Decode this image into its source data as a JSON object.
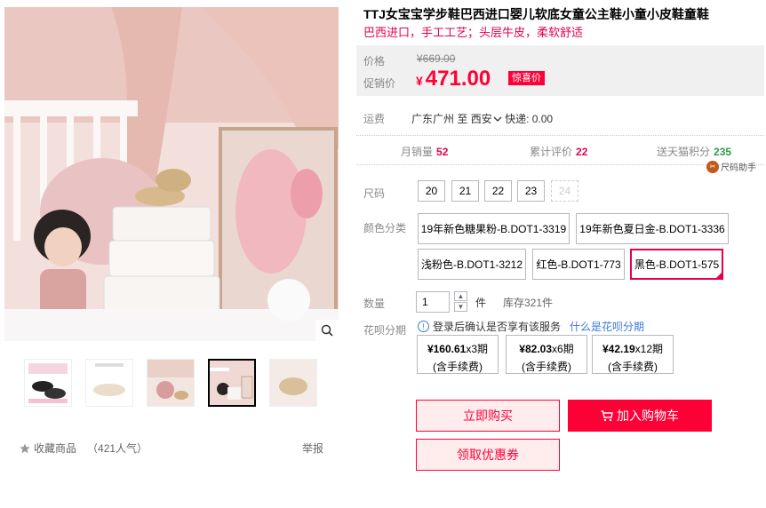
{
  "product": {
    "title": "TTJ女宝宝学步鞋巴西进口婴儿软底女童公主鞋小童小皮鞋童鞋",
    "subtitle": "巴西进口，手工工艺；头层牛皮，柔软舒适"
  },
  "price": {
    "label": "价格",
    "original": "¥669.00",
    "promo_label": "促销价",
    "currency": "¥",
    "current": "471.00",
    "promo_tag": "惊喜价"
  },
  "shipping": {
    "label": "运费",
    "origin": "广东广州",
    "to": "至",
    "destination": "西安",
    "express": "快递: 0.00"
  },
  "stats": {
    "monthly_sales_label": "月销量",
    "monthly_sales": "52",
    "reviews_label": "累计评价",
    "reviews": "22",
    "points_label": "送天猫积分",
    "points": "235"
  },
  "size_helper": {
    "label": "尺码助手"
  },
  "size": {
    "label": "尺码",
    "options": [
      "20",
      "21",
      "22",
      "23",
      "24"
    ]
  },
  "color": {
    "label": "颜色分类",
    "options": [
      "19年新色糖果粉-B.DOT1-3319",
      "19年新色夏日金-B.DOT1-3336",
      "浅粉色-B.DOT1-3212",
      "红色-B.DOT1-773",
      "黑色-B.DOT1-575"
    ],
    "selected": "黑色-B.DOT1-575"
  },
  "quantity": {
    "label": "数量",
    "value": "1",
    "unit": "件",
    "stock": "库存321件"
  },
  "huabei": {
    "label": "花呗分期",
    "notice": "登录后确认是否享有该服务",
    "link": "什么是花呗分期",
    "plans": [
      {
        "amount": "¥160.61",
        "period": "x3期",
        "fee": "(含手续费)"
      },
      {
        "amount": "¥82.03",
        "period": "x6期",
        "fee": "(含手续费)"
      },
      {
        "amount": "¥42.19",
        "period": "x12期",
        "fee": "(含手续费)"
      }
    ]
  },
  "actions": {
    "buy_now": "立即购买",
    "add_to_cart": "加入购物车",
    "get_coupon": "领取优惠券"
  },
  "gallery": {
    "favorite_label": "收藏商品",
    "favorite_count": "（421人气）",
    "report": "举报"
  },
  "colors": {
    "accent": "#ff0036",
    "accent_dark": "#e5004f",
    "link": "#3b7ad9",
    "price_bg": "#f0f0f0"
  }
}
